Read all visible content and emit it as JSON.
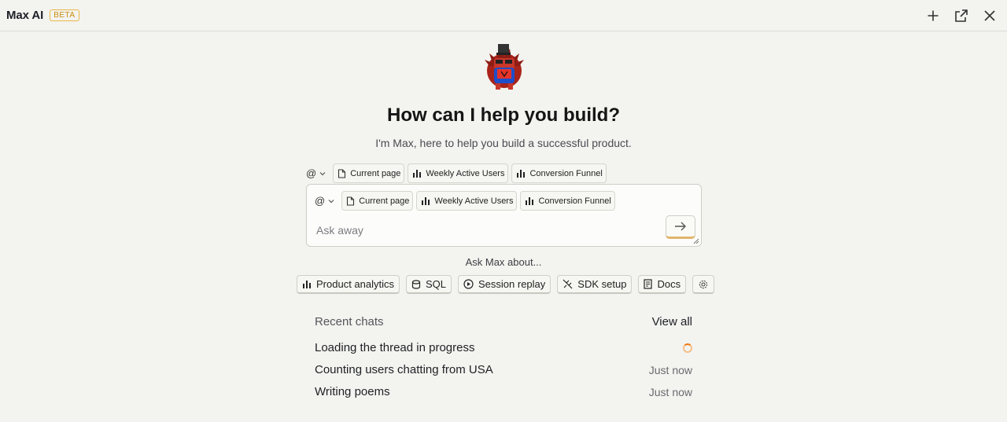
{
  "header": {
    "title": "Max AI",
    "badge": "BETA",
    "actions": [
      {
        "name": "new-chat",
        "icon": "plus-icon"
      },
      {
        "name": "open-in-new",
        "icon": "external-link-icon"
      },
      {
        "name": "close",
        "icon": "close-icon"
      }
    ]
  },
  "hero": {
    "title": "How can I help you build?",
    "subtitle": "I'm Max, here to help you build a successful product."
  },
  "context": {
    "at_label": "@",
    "chips": [
      {
        "label": "Current page",
        "icon": "document-icon"
      },
      {
        "label": "Weekly Active Users",
        "icon": "bar-chart-icon"
      },
      {
        "label": "Conversion Funnel",
        "icon": "bar-chart-icon"
      }
    ]
  },
  "input": {
    "placeholder": "Ask away",
    "value": ""
  },
  "suggestions": {
    "label": "Ask Max about...",
    "items": [
      {
        "label": "Product analytics",
        "icon": "bar-chart-icon"
      },
      {
        "label": "SQL",
        "icon": "database-icon"
      },
      {
        "label": "Session replay",
        "icon": "play-icon"
      },
      {
        "label": "SDK setup",
        "icon": "plug-icon"
      },
      {
        "label": "Docs",
        "icon": "book-icon"
      },
      {
        "label": "",
        "icon": "gear-icon"
      }
    ]
  },
  "recent": {
    "title": "Recent chats",
    "view_all": "View all",
    "chats": [
      {
        "title": "Loading the thread in progress",
        "time": "",
        "status": "loading"
      },
      {
        "title": "Counting users chatting from USA",
        "time": "Just now"
      },
      {
        "title": "Writing poems",
        "time": "Just now"
      }
    ]
  },
  "colors": {
    "background": "#f3f3ef",
    "accent": "#f1770e",
    "beta": "#c98d0c"
  }
}
